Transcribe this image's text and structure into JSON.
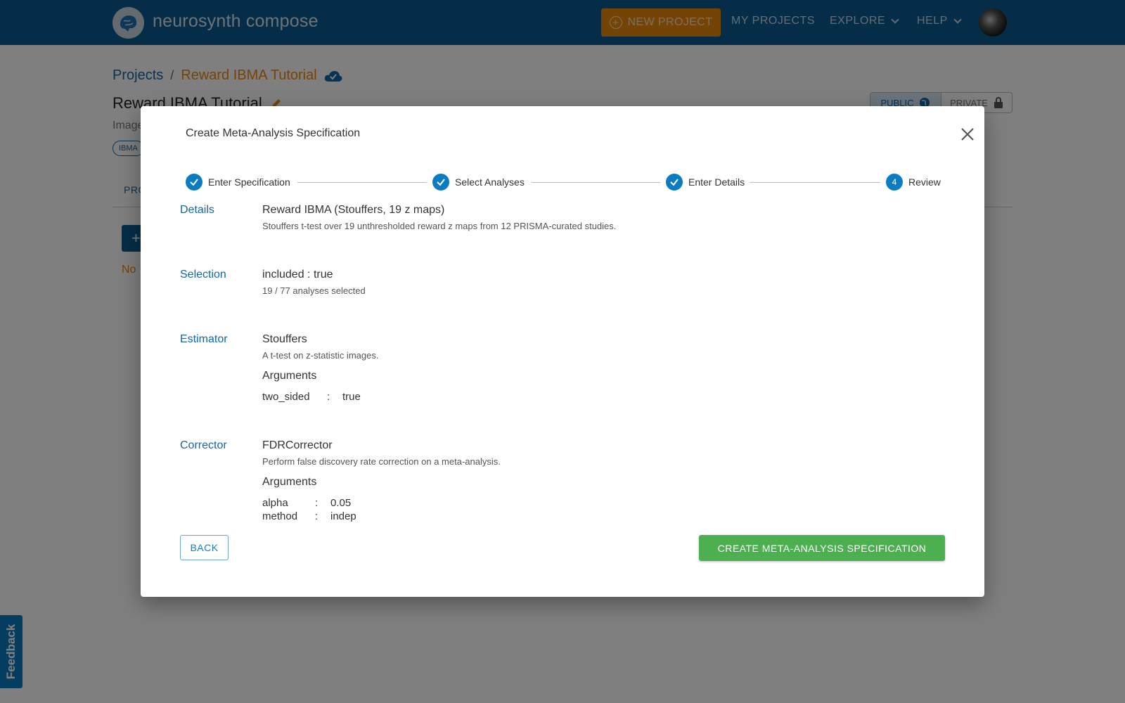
{
  "topbar": {
    "brand": "neurosynth compose",
    "new_project_label": "NEW PROJECT",
    "my_projects_label": "MY PROJECTS",
    "explore_label": "EXPLORE",
    "help_label": "HELP"
  },
  "page": {
    "breadcrumb_projects": "Projects",
    "breadcrumb_separator": "/",
    "breadcrumb_current": "Reward IBMA Tutorial",
    "title": "Reward IBMA Tutorial",
    "subtitle_partial": "Image",
    "tag_partial": "IBMA",
    "visibility_public": "PUBLIC",
    "visibility_private": "PRIVATE",
    "tab_partial": "PRO",
    "plus_partial": "+",
    "note_partial": "No"
  },
  "feedback_label": "Feedback",
  "modal": {
    "title": "Create Meta-Analysis Specification",
    "steps": [
      {
        "label": "Enter Specification",
        "state": "complete"
      },
      {
        "label": "Select Analyses",
        "state": "complete"
      },
      {
        "label": "Enter Details",
        "state": "complete"
      },
      {
        "label": "Review",
        "state": "active",
        "number": "4"
      }
    ],
    "details": {
      "label": "Details",
      "name": "Reward IBMA (Stouffers, 19 z maps)",
      "description": "Stouffers t-test over 19 unthresholded reward z maps from 12 PRISMA-curated studies."
    },
    "selection": {
      "label": "Selection",
      "filter": "included : true",
      "count_text": "19 / 77 analyses selected"
    },
    "estimator": {
      "label": "Estimator",
      "name": "Stouffers",
      "description": "A t-test on z-statistic images.",
      "arguments_heading": "Arguments",
      "arguments": [
        {
          "key": "two_sided",
          "sep": ":",
          "value": "true"
        }
      ]
    },
    "corrector": {
      "label": "Corrector",
      "name": "FDRCorrector",
      "description": "Perform false discovery rate correction on a meta-analysis.",
      "arguments_heading": "Arguments",
      "arguments": [
        {
          "key": "alpha",
          "sep": ":",
          "value": "0.05"
        },
        {
          "key": "method",
          "sep": ":",
          "value": "indep"
        }
      ]
    },
    "back_label": "BACK",
    "create_label": "CREATE META-ANALYSIS SPECIFICATION"
  },
  "colors": {
    "nav": "#0b5a8e",
    "accent_orange": "#e8890c",
    "primary_blue": "#0b7bc2",
    "create_green": "#4caf50"
  }
}
